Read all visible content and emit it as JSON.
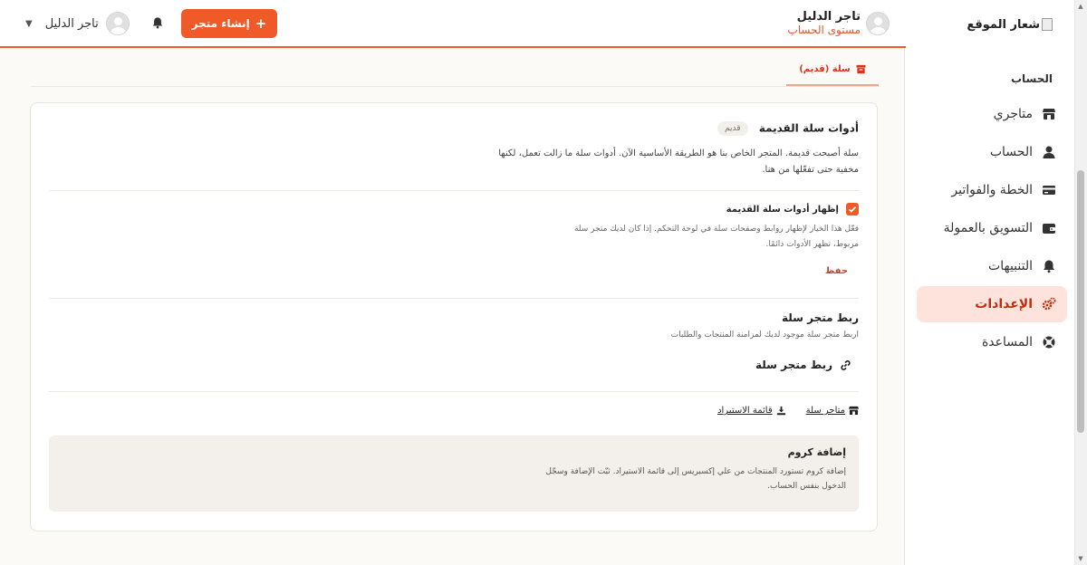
{
  "colors": {
    "accent": "#f05a28",
    "active_bg": "#fde3dc",
    "active_text": "#c42a0c"
  },
  "sidebar": {
    "logo_alt": "شعار الموقع",
    "section_label": "الحساب",
    "items": [
      {
        "label": "متاجري",
        "icon": "store-icon",
        "active": false
      },
      {
        "label": "الحساب",
        "icon": "user-icon",
        "active": false
      },
      {
        "label": "الخطة والفواتير",
        "icon": "credit-card-icon",
        "active": false
      },
      {
        "label": "التسويق بالعمولة",
        "icon": "wallet-icon",
        "active": false
      },
      {
        "label": "التنبيهات",
        "icon": "bell-icon",
        "active": false
      },
      {
        "label": "الإعدادات",
        "icon": "gears-icon",
        "active": true
      },
      {
        "label": "المساعدة",
        "icon": "lifebuoy-icon",
        "active": false
      }
    ]
  },
  "header": {
    "account_name": "تاجر الدليل",
    "account_level": "مستوى الحساب",
    "create_store_label": "إنشاء متجر",
    "user_name": "تاجر الدليل"
  },
  "tab": {
    "label": "سلة (قديم)"
  },
  "legacy_tools": {
    "title": "أدوات سلة القديمة",
    "badge": "قديم",
    "description": "سلة أصبحت قديمة. المتجر الخاص بنا هو الطريقة الأساسية الآن. أدوات سلة ما زالت تعمل، لكنها مخفية حتى تفعّلها من هنا.",
    "checkbox_label": "إظهار أدوات سلة القديمة",
    "checkbox_checked": true,
    "checkbox_help": "فعّل هذا الخيار لإظهار روابط وصفحات سلة في لوحة التحكم. إذا كان لديك متجر سلة مربوط، تظهر الأدوات دائمًا.",
    "save_label": "حفظ"
  },
  "connect": {
    "title": "ربط متجر سلة",
    "description": "اربط متجر سلة موجود لديك لمزامنة المنتجات والطلبات",
    "button_label": "ربط متجر سلة"
  },
  "links": {
    "stores_label": "متاجر سلة",
    "import_list_label": "قائمة الاستيراد"
  },
  "chrome_ext": {
    "title": "إضافة كروم",
    "description": "إضافة كروم تستورد المنتجات من علي إكسبريس إلى قائمة الاستيراد. ثبّت الإضافة وسجّل الدخول بنفس الحساب."
  }
}
